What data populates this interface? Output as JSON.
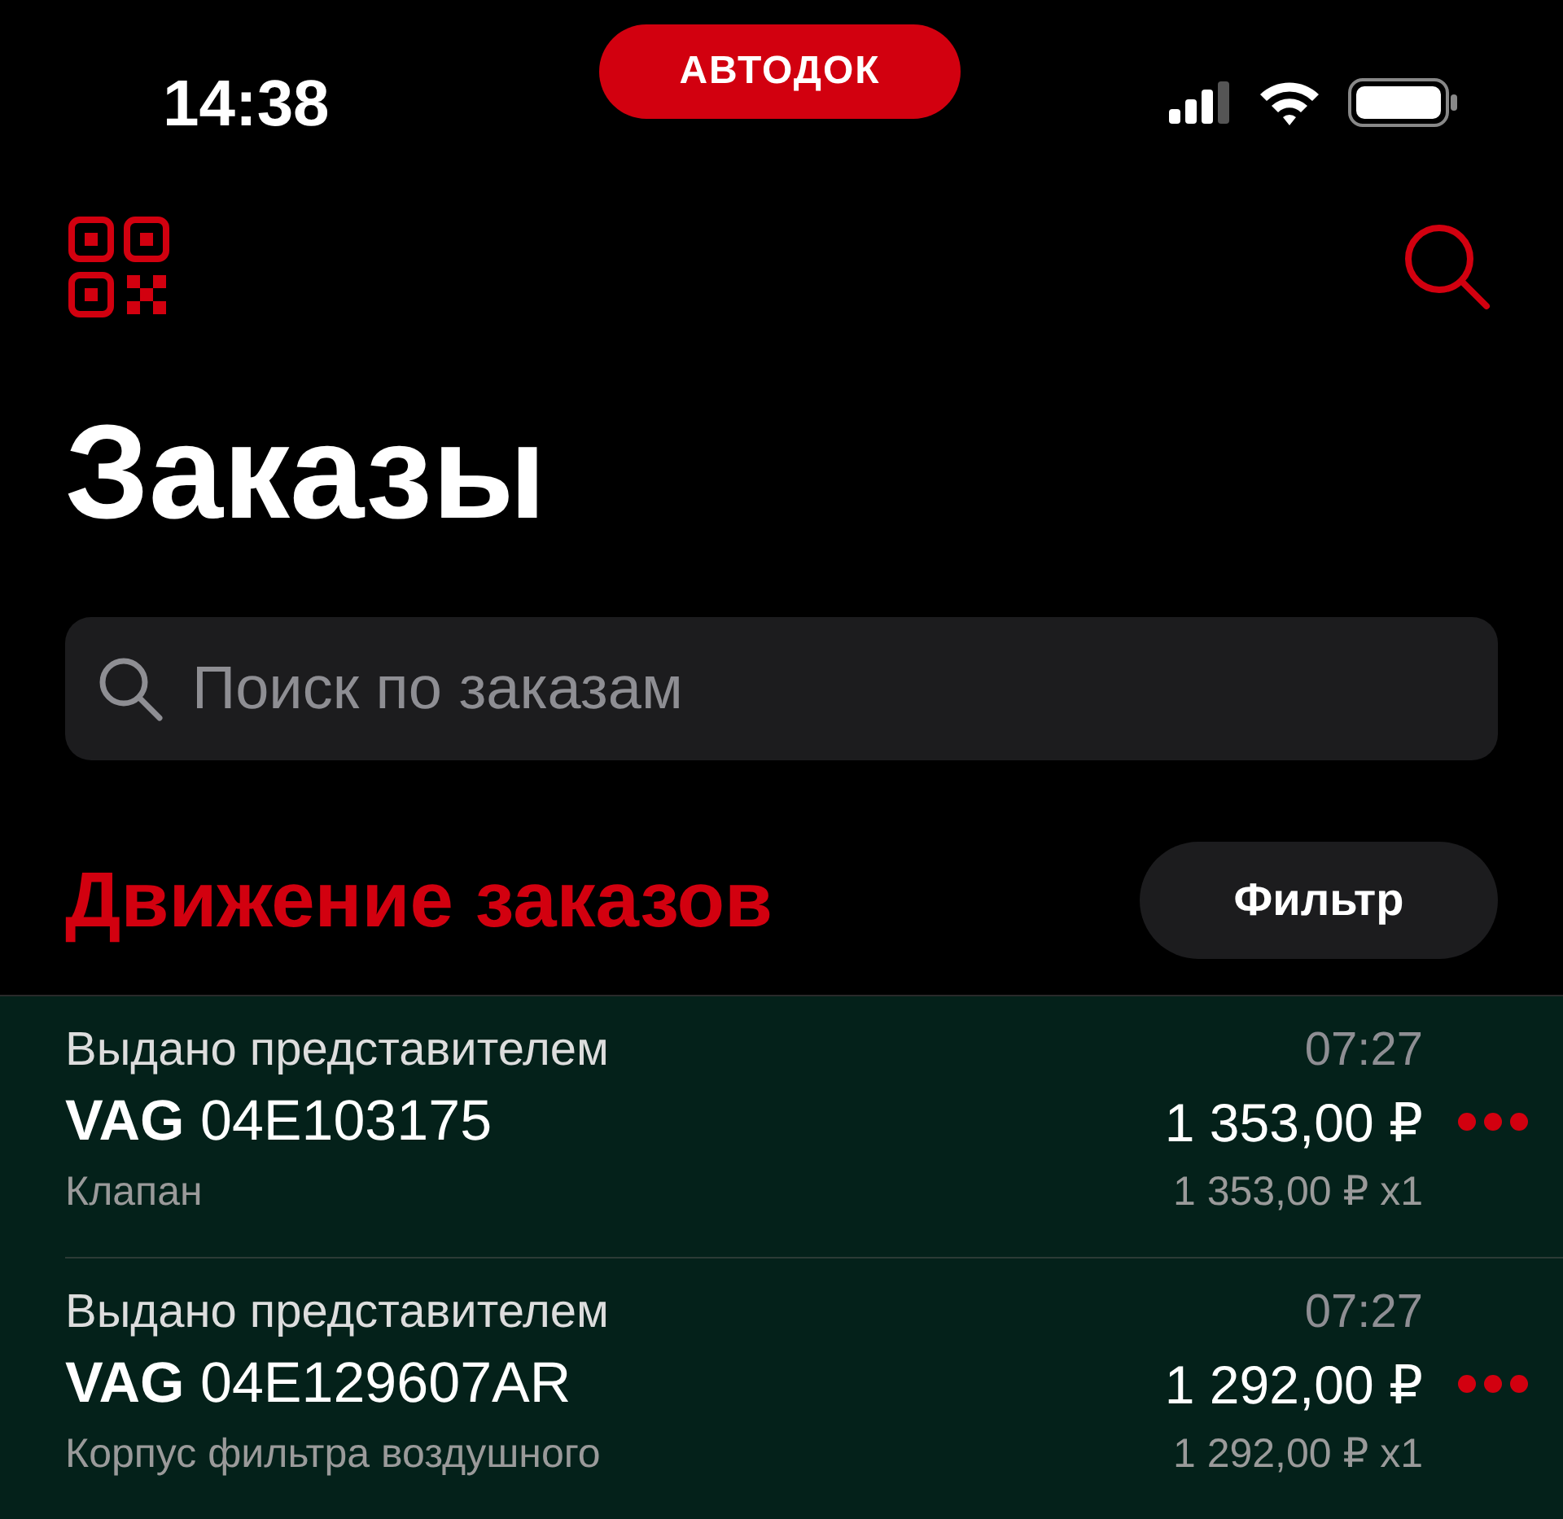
{
  "status_bar": {
    "time": "14:38",
    "badge": "АВТОДОК"
  },
  "title": "Заказы",
  "search": {
    "placeholder": "Поиск по заказам"
  },
  "section": {
    "title": "Движение заказов",
    "filter_button": "Фильтр"
  },
  "orders": [
    {
      "status": "Выдано представителем",
      "time": "07:27",
      "article": "**VAG** 04E103175",
      "price": "1 353,00 ₽",
      "name": "Клапан",
      "unit_price": "1 353,00 ₽ x1"
    },
    {
      "status": "Выдано представителем",
      "time": "07:27",
      "article": "**VAG** 04E129607AR",
      "price": "1 292,00 ₽",
      "name": "Корпус фильтра воздушного",
      "unit_price": "1 292,00 ₽ x1"
    }
  ]
}
